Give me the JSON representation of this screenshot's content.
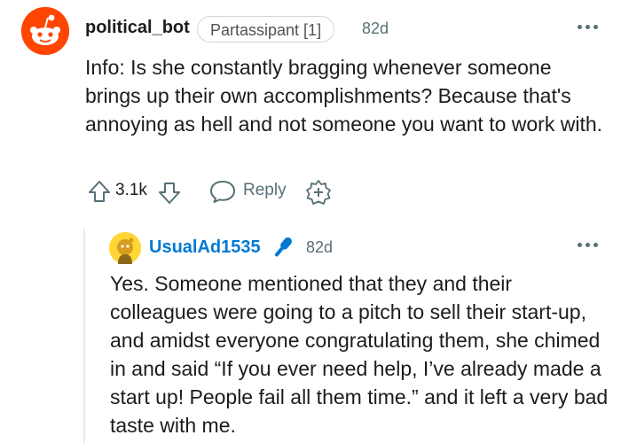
{
  "comment": {
    "username": "political_bot",
    "flair": "Partassipant [1]",
    "age": "82d",
    "body": "Info: Is she constantly bragging whenever someone brings up their own accomplishments? Because that's annoying as hell and not someone you want to work with.",
    "score": "3.1k",
    "reply_label": "Reply",
    "icons": [
      "reddit-snoo-avatar",
      "more-options-icon",
      "upvote-icon",
      "downvote-icon",
      "reply-bubble-icon",
      "award-icon"
    ]
  },
  "reply": {
    "username": "UsualAd1535",
    "age": "82d",
    "body": "Yes. Someone mentioned that they and their colleagues were going to a pitch to sell their start-up, and amidst everyone congratulating them, she chimed in and said “If you ever need help, I’ve already made a start up! People fail all them time.” and it left a very bad taste with me.",
    "icons": [
      "snoo-avatar-yellow",
      "op-microphone-icon",
      "more-options-icon"
    ]
  },
  "colors": {
    "avatar_orange": "#ff4500",
    "avatar_yellow": "#ffd635",
    "username_blue": "#0079d3",
    "mic_blue": "#0079d3",
    "meta_gray": "#576f76"
  }
}
